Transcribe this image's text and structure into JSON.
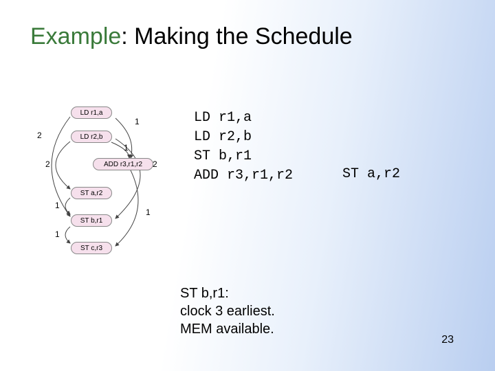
{
  "title": {
    "example": "Example",
    "rest": ": Making the Schedule"
  },
  "code": {
    "line1": "LD r1,a",
    "line2": "LD r2,b",
    "line3": "ST b,r1",
    "line4": "ADD r3,r1,r2",
    "col2_line4": "ST a,r2"
  },
  "annotation": {
    "l1": "ST b,r1:",
    "l2": "clock 3 earliest.",
    "l3": "MEM available."
  },
  "slide_number": "23",
  "graph": {
    "nodes": {
      "n1": "LD r1,a",
      "n2": "LD r2,b",
      "n3": "ADD r3,r1,r2",
      "n4": "ST a,r2",
      "n5": "ST b,r1",
      "n6": "ST c,r3"
    },
    "edge_labels": {
      "e_n1_n3": "1",
      "e_n2_n3": "1",
      "e_n1_n5": "2",
      "e_n2_n4": "2",
      "e_n2_n5": "2",
      "e_n3_n6": "1",
      "e_left1": "1",
      "e_left2": "1"
    }
  }
}
